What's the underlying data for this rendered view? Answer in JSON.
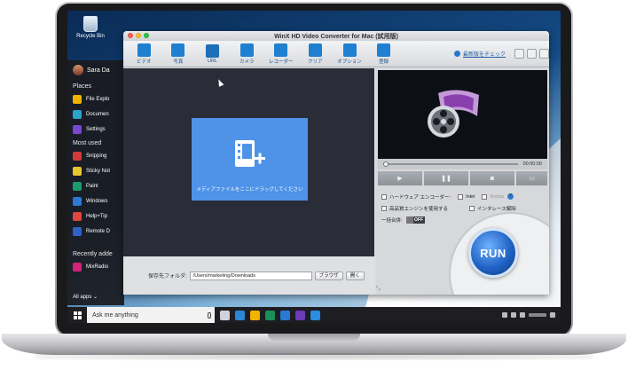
{
  "desktop": {
    "recycle_bin_label": "Recycle Bin"
  },
  "start_menu": {
    "user_name": "Sara Da",
    "places_label": "Places",
    "places": [
      {
        "label": "File Explo",
        "color": "#f0b400"
      },
      {
        "label": "Documen",
        "color": "#2aa3c9"
      },
      {
        "label": "Settings",
        "color": "#7a47d1"
      }
    ],
    "most_used_label": "Most used",
    "most_used": [
      {
        "label": "Snipping",
        "color": "#d33a3a"
      },
      {
        "label": "Sticky Not",
        "color": "#e6c72e"
      },
      {
        "label": "Paint",
        "color": "#1d9a6c"
      },
      {
        "label": "Windows",
        "color": "#2a7ad1"
      },
      {
        "label": "Help+Tip",
        "color": "#e0473c"
      },
      {
        "label": "Remote D",
        "color": "#2d62c8"
      }
    ],
    "recently_added_label": "Recently adde",
    "recently_added": [
      {
        "label": "MixRadio",
        "color": "#d2237a"
      }
    ],
    "all_apps_label": "All apps ⌄"
  },
  "taskbar": {
    "search_placeholder": "Ask me anything",
    "icons": [
      {
        "name": "task-view-icon",
        "color": "#cfd3d8"
      },
      {
        "name": "edge-icon",
        "color": "#2c87d6"
      },
      {
        "name": "explorer-icon",
        "color": "#f0b400"
      },
      {
        "name": "store-icon",
        "color": "#1b8f5a"
      },
      {
        "name": "phone-icon",
        "color": "#2a7ad1"
      },
      {
        "name": "trophy-icon",
        "color": "#6b3bb8"
      },
      {
        "name": "pen-icon",
        "color": "#2a8de0"
      }
    ]
  },
  "app": {
    "title": "WinX HD Video Converter for Mac (試用版)",
    "toolbar": [
      {
        "label": "ビデオ",
        "icon": "video-add-icon"
      },
      {
        "label": "写真",
        "icon": "photo-icon"
      },
      {
        "label": "URL",
        "icon": "youtube-icon"
      },
      {
        "label": "カメラ",
        "icon": "camera-icon"
      },
      {
        "label": "レコーダー",
        "icon": "recorder-icon"
      },
      {
        "label": "クリア",
        "icon": "trash-icon"
      },
      {
        "label": "オプション",
        "icon": "tools-icon"
      },
      {
        "label": "登録",
        "icon": "key-icon"
      }
    ],
    "check_update": "最新版をチェック",
    "dropzone_text": "メディアファイルをここにドラッグしてください",
    "output_folder_label": "保存先フォルダ:",
    "output_path": "/Users/marketing/Downloads",
    "browse_label": "ブラウザ",
    "open_label": "開く",
    "preview_time": "00:00:00",
    "hw_encoder_label": "ハードウェア エンコーダー:",
    "intel_label": "Intel",
    "nvidia_label": "Nvidia",
    "high_quality_label": "高品質エンジンを使用する",
    "deinterlace_label": "インタレース解除",
    "merge_label": "一括合併:",
    "merge_toggle": "OFF",
    "run_label": "RUN",
    "colors": {
      "accent": "#1f7fd0",
      "dropzone": "#4f93e8",
      "run": "#2163c5"
    }
  }
}
